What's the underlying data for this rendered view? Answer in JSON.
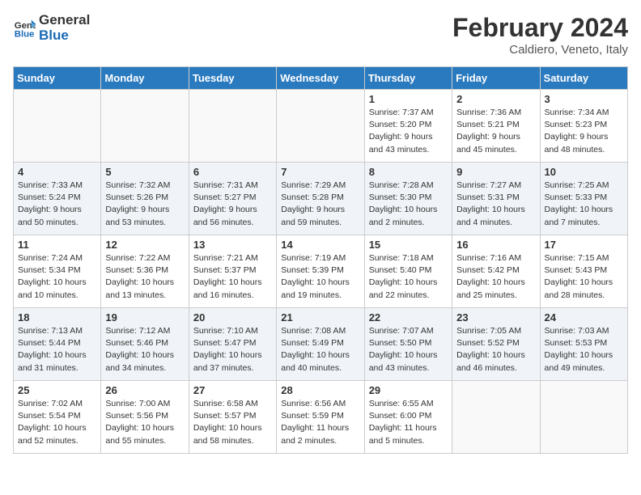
{
  "header": {
    "logo_line1": "General",
    "logo_line2": "Blue",
    "month": "February 2024",
    "location": "Caldiero, Veneto, Italy"
  },
  "days_of_week": [
    "Sunday",
    "Monday",
    "Tuesday",
    "Wednesday",
    "Thursday",
    "Friday",
    "Saturday"
  ],
  "weeks": [
    [
      {
        "num": "",
        "info": ""
      },
      {
        "num": "",
        "info": ""
      },
      {
        "num": "",
        "info": ""
      },
      {
        "num": "",
        "info": ""
      },
      {
        "num": "1",
        "info": "Sunrise: 7:37 AM\nSunset: 5:20 PM\nDaylight: 9 hours\nand 43 minutes."
      },
      {
        "num": "2",
        "info": "Sunrise: 7:36 AM\nSunset: 5:21 PM\nDaylight: 9 hours\nand 45 minutes."
      },
      {
        "num": "3",
        "info": "Sunrise: 7:34 AM\nSunset: 5:23 PM\nDaylight: 9 hours\nand 48 minutes."
      }
    ],
    [
      {
        "num": "4",
        "info": "Sunrise: 7:33 AM\nSunset: 5:24 PM\nDaylight: 9 hours\nand 50 minutes."
      },
      {
        "num": "5",
        "info": "Sunrise: 7:32 AM\nSunset: 5:26 PM\nDaylight: 9 hours\nand 53 minutes."
      },
      {
        "num": "6",
        "info": "Sunrise: 7:31 AM\nSunset: 5:27 PM\nDaylight: 9 hours\nand 56 minutes."
      },
      {
        "num": "7",
        "info": "Sunrise: 7:29 AM\nSunset: 5:28 PM\nDaylight: 9 hours\nand 59 minutes."
      },
      {
        "num": "8",
        "info": "Sunrise: 7:28 AM\nSunset: 5:30 PM\nDaylight: 10 hours\nand 2 minutes."
      },
      {
        "num": "9",
        "info": "Sunrise: 7:27 AM\nSunset: 5:31 PM\nDaylight: 10 hours\nand 4 minutes."
      },
      {
        "num": "10",
        "info": "Sunrise: 7:25 AM\nSunset: 5:33 PM\nDaylight: 10 hours\nand 7 minutes."
      }
    ],
    [
      {
        "num": "11",
        "info": "Sunrise: 7:24 AM\nSunset: 5:34 PM\nDaylight: 10 hours\nand 10 minutes."
      },
      {
        "num": "12",
        "info": "Sunrise: 7:22 AM\nSunset: 5:36 PM\nDaylight: 10 hours\nand 13 minutes."
      },
      {
        "num": "13",
        "info": "Sunrise: 7:21 AM\nSunset: 5:37 PM\nDaylight: 10 hours\nand 16 minutes."
      },
      {
        "num": "14",
        "info": "Sunrise: 7:19 AM\nSunset: 5:39 PM\nDaylight: 10 hours\nand 19 minutes."
      },
      {
        "num": "15",
        "info": "Sunrise: 7:18 AM\nSunset: 5:40 PM\nDaylight: 10 hours\nand 22 minutes."
      },
      {
        "num": "16",
        "info": "Sunrise: 7:16 AM\nSunset: 5:42 PM\nDaylight: 10 hours\nand 25 minutes."
      },
      {
        "num": "17",
        "info": "Sunrise: 7:15 AM\nSunset: 5:43 PM\nDaylight: 10 hours\nand 28 minutes."
      }
    ],
    [
      {
        "num": "18",
        "info": "Sunrise: 7:13 AM\nSunset: 5:44 PM\nDaylight: 10 hours\nand 31 minutes."
      },
      {
        "num": "19",
        "info": "Sunrise: 7:12 AM\nSunset: 5:46 PM\nDaylight: 10 hours\nand 34 minutes."
      },
      {
        "num": "20",
        "info": "Sunrise: 7:10 AM\nSunset: 5:47 PM\nDaylight: 10 hours\nand 37 minutes."
      },
      {
        "num": "21",
        "info": "Sunrise: 7:08 AM\nSunset: 5:49 PM\nDaylight: 10 hours\nand 40 minutes."
      },
      {
        "num": "22",
        "info": "Sunrise: 7:07 AM\nSunset: 5:50 PM\nDaylight: 10 hours\nand 43 minutes."
      },
      {
        "num": "23",
        "info": "Sunrise: 7:05 AM\nSunset: 5:52 PM\nDaylight: 10 hours\nand 46 minutes."
      },
      {
        "num": "24",
        "info": "Sunrise: 7:03 AM\nSunset: 5:53 PM\nDaylight: 10 hours\nand 49 minutes."
      }
    ],
    [
      {
        "num": "25",
        "info": "Sunrise: 7:02 AM\nSunset: 5:54 PM\nDaylight: 10 hours\nand 52 minutes."
      },
      {
        "num": "26",
        "info": "Sunrise: 7:00 AM\nSunset: 5:56 PM\nDaylight: 10 hours\nand 55 minutes."
      },
      {
        "num": "27",
        "info": "Sunrise: 6:58 AM\nSunset: 5:57 PM\nDaylight: 10 hours\nand 58 minutes."
      },
      {
        "num": "28",
        "info": "Sunrise: 6:56 AM\nSunset: 5:59 PM\nDaylight: 11 hours\nand 2 minutes."
      },
      {
        "num": "29",
        "info": "Sunrise: 6:55 AM\nSunset: 6:00 PM\nDaylight: 11 hours\nand 5 minutes."
      },
      {
        "num": "",
        "info": ""
      },
      {
        "num": "",
        "info": ""
      }
    ]
  ]
}
